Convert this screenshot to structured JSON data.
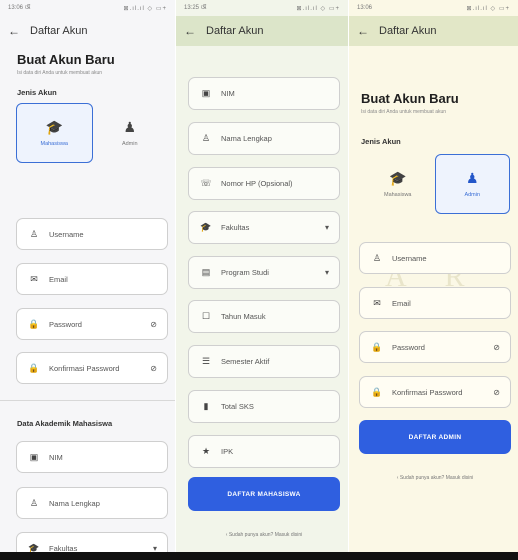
{
  "colors": {
    "accent": "#2f5fe0",
    "selected_bg": "#eef3fd"
  },
  "panel1": {
    "status": {
      "time": "13:06",
      "extra": "ଔ",
      "icons": "⊠.ıl.ıl ◇ ▭+"
    },
    "appbar": {
      "back_icon": "arrow-left-icon",
      "title": "Daftar Akun"
    },
    "title": "Buat Akun Baru",
    "subtitle": "Isi data diri Anda untuk membuat akun",
    "role_section": "Jenis Akun",
    "roles": [
      {
        "label": "Mahasiswa",
        "icon": "graduation-cap-icon",
        "selected": true
      },
      {
        "label": "Admin",
        "icon": "admin-icon",
        "selected": false
      }
    ],
    "fields": [
      {
        "label": "Username",
        "icon": "person-icon"
      },
      {
        "label": "Email",
        "icon": "mail-icon"
      },
      {
        "label": "Password",
        "icon": "lock-icon",
        "trailing": "eye-off-icon"
      },
      {
        "label": "Konfirmasi Password",
        "icon": "lock-icon",
        "trailing": "eye-off-icon"
      }
    ],
    "academic_section": "Data Akademik Mahasiswa",
    "academic_fields": [
      {
        "label": "NIM",
        "icon": "id-badge-icon"
      },
      {
        "label": "Nama Lengkap",
        "icon": "person-icon"
      },
      {
        "label": "Fakultas",
        "icon": "graduation-cap-icon",
        "trailing": "dropdown-icon"
      }
    ]
  },
  "panel2": {
    "status": {
      "time": "13:25",
      "extra": "ଔ",
      "icons": "⊠.ıl.ıl ◇ ▭+"
    },
    "appbar": {
      "back_icon": "arrow-left-icon",
      "title": "Daftar Akun"
    },
    "fields": [
      {
        "label": "NIM",
        "icon": "id-badge-icon"
      },
      {
        "label": "Nama Lengkap",
        "icon": "person-icon"
      },
      {
        "label": "Nomor HP (Opsional)",
        "icon": "phone-icon"
      },
      {
        "label": "Fakultas",
        "icon": "graduation-cap-icon",
        "trailing": "dropdown-icon"
      },
      {
        "label": "Program Studi",
        "icon": "building-icon",
        "trailing": "dropdown-icon"
      },
      {
        "label": "Tahun Masuk",
        "icon": "calendar-icon"
      },
      {
        "label": "Semester Aktif",
        "icon": "list-icon"
      },
      {
        "label": "Total SKS",
        "icon": "book-icon"
      },
      {
        "label": "IPK",
        "icon": "star-icon"
      }
    ],
    "submit": "DAFTAR MAHASISWA",
    "login_link": "Sudah punya akun? Masuk disini"
  },
  "panel3": {
    "status": {
      "time": "13:06",
      "icons": "⊠.ıl.ıl ◇ ▭+"
    },
    "appbar": {
      "back_icon": "arrow-left-icon",
      "title": "Daftar Akun"
    },
    "title": "Buat Akun Baru",
    "subtitle": "Isi data diri Anda untuk membuat akun",
    "role_section": "Jenis Akun",
    "roles": [
      {
        "label": "Mahasiswa",
        "icon": "graduation-cap-icon",
        "selected": false
      },
      {
        "label": "Admin",
        "icon": "admin-icon",
        "selected": true
      }
    ],
    "fields": [
      {
        "label": "Username",
        "icon": "person-icon"
      },
      {
        "label": "Email",
        "icon": "mail-icon"
      },
      {
        "label": "Password",
        "icon": "lock-icon",
        "trailing": "eye-off-icon"
      },
      {
        "label": "Konfirmasi Password",
        "icon": "lock-icon",
        "trailing": "eye-off-icon"
      }
    ],
    "submit": "DAFTAR ADMIN",
    "login_link": "Sudah punya akun? Masuk disini",
    "watermark": "A R"
  }
}
